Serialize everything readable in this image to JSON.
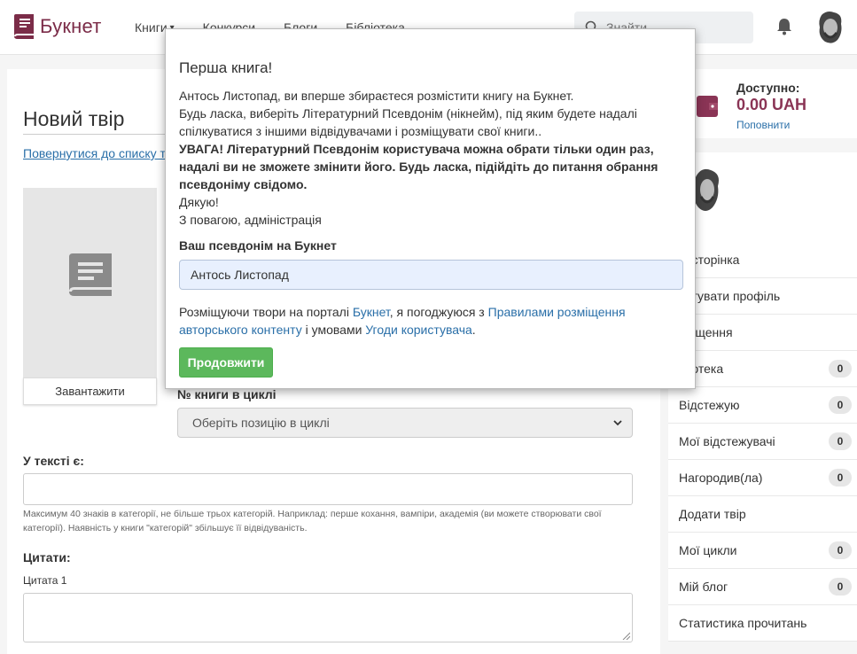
{
  "header": {
    "logo_text": "Букнет",
    "nav": [
      {
        "label": "Книги"
      },
      {
        "label": "Конкурси"
      },
      {
        "label": "Блоги"
      },
      {
        "label": "Бібліотека"
      }
    ],
    "search_placeholder": "Знайти",
    "icons": {
      "logo": "book-logo-icon",
      "search": "search-icon",
      "bell": "bell-icon",
      "dropdown": "chevron-down-icon"
    }
  },
  "page": {
    "title": "Новий твір",
    "back_link": "Повернутися до списку т",
    "upload_button": "Завантажити",
    "cycle_label": "№ книги в циклі",
    "cycle_select_value": "Оберіть позицію в циклі",
    "tags_label": "У тексті є:",
    "tags_hint": "Максимум 40 знаків в категорії, не більше трьох категорій. Наприклад: перше кохання, вампіри, академія (ви можете створювати свої категорії). Наявність у книги \"категорій\" збільшує її відвідуваність.",
    "quotes_label": "Цитати:",
    "quote1_label": "Цитата 1"
  },
  "sidebar": {
    "balance_label": "Доступно:",
    "balance_amount": "0.00 UAH",
    "balance_topup": "Поповнити",
    "menu": [
      {
        "label": "ія сторінка",
        "count": null
      },
      {
        "label": "дагувати профіль",
        "count": null
      },
      {
        "label": "овіщення",
        "count": null
      },
      {
        "label": "іліотека",
        "count": "0"
      },
      {
        "label": "Відстежую",
        "count": "0"
      },
      {
        "label": "Мої відстежувачі",
        "count": "0"
      },
      {
        "label": "Нагородив(ла)",
        "count": "0"
      },
      {
        "label": "Додати твір",
        "count": null
      },
      {
        "label": "Мої цикли",
        "count": "0"
      },
      {
        "label": "Мій блог",
        "count": "0"
      },
      {
        "label": "Статистика прочитань",
        "count": null
      }
    ]
  },
  "modal": {
    "title": "Перша книга!",
    "line1": "Антось Листопад, ви вперше збираєтеся розмістити книгу на Букнет.",
    "line2": "Будь ласка, виберіть Літературний Псевдонім (нікнейм), під яким будете надалі спілкуватися з іншими відвідувачами і розміщувати свої книги..",
    "warning": "УВАГА! Літературний Псевдонім користувача можна обрати тільки один раз, надалі ви не зможете змінити його. Будь ласка, підійдіть до питання обрання псевдоніму свідомо.",
    "thanks": "Дякую!",
    "regards": "З повагою, адміністрація",
    "alias_label": "Ваш псевдонім на Букнет",
    "alias_value": "Антось Листопад",
    "agree_prefix": "Розміщуючи твори на порталі ",
    "agree_link_site": "Букнет",
    "agree_mid": ", я погоджуюся з ",
    "agree_link_rules": "Правилами розміщення авторського контенту",
    "agree_and": " і умовами ",
    "agree_link_terms": "Угоди користувача",
    "agree_end": ".",
    "continue_button": "Продовжити"
  },
  "colors": {
    "brand": "#7b2c48",
    "link": "#2a6fa8",
    "success": "#5cb85c"
  }
}
